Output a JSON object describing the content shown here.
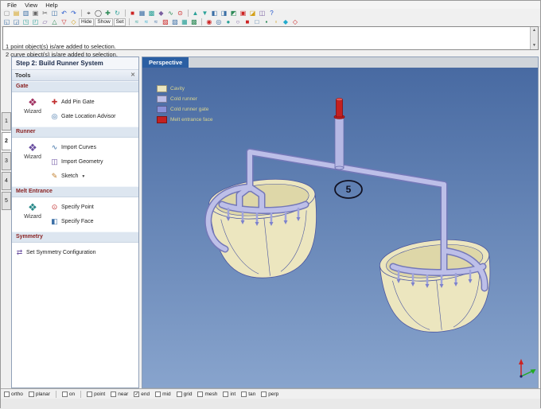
{
  "menu": {
    "items": [
      "File",
      "View",
      "Help"
    ]
  },
  "toolbars": {
    "row1": [
      {
        "n": "new-file",
        "g": "▢",
        "c": "#888888"
      },
      {
        "n": "open-file",
        "g": "▤",
        "c": "#d4a017"
      },
      {
        "n": "save-file",
        "g": "▥",
        "c": "#3a6ea5"
      },
      {
        "n": "print",
        "g": "▣",
        "c": "#666666"
      },
      {
        "n": "cut",
        "g": "✂",
        "c": "#555555"
      },
      {
        "n": "copy",
        "g": "◫",
        "c": "#3a6ea5"
      },
      {
        "n": "undo",
        "g": "↶",
        "c": "#2255cc"
      },
      {
        "n": "redo",
        "g": "↷",
        "c": "#2255cc"
      },
      {
        "type": "sep"
      },
      {
        "n": "select",
        "g": "⌖",
        "c": "#333333"
      },
      {
        "n": "zoom",
        "g": "◯",
        "c": "#333333"
      },
      {
        "n": "pan",
        "g": "✚",
        "c": "#2e8b57"
      },
      {
        "n": "rotate-view",
        "g": "↻",
        "c": "#2aa198"
      },
      {
        "type": "sep"
      },
      {
        "n": "stop",
        "g": "■",
        "c": "#cc2222"
      },
      {
        "n": "grid-display",
        "g": "▦",
        "c": "#3a6ea5"
      },
      {
        "n": "mesh-tool",
        "g": "▩",
        "c": "#2aa198"
      },
      {
        "n": "surface-tool",
        "g": "◆",
        "c": "#7a5fa0"
      },
      {
        "n": "curve-tool",
        "g": "∿",
        "c": "#2e8b57"
      },
      {
        "n": "point-tool",
        "g": "⊙",
        "c": "#cc2222"
      },
      {
        "type": "sep"
      },
      {
        "n": "analysis-up",
        "g": "▲",
        "c": "#2aa198"
      },
      {
        "n": "analysis-down",
        "g": "▼",
        "c": "#2aa198"
      },
      {
        "n": "shade-left",
        "g": "◧",
        "c": "#3a6ea5"
      },
      {
        "n": "shade-right",
        "g": "◨",
        "c": "#3a6ea5"
      },
      {
        "n": "shade-corner",
        "g": "◩",
        "c": "#2e8b57"
      },
      {
        "n": "flag-red",
        "g": "▣",
        "c": "#cc2222"
      },
      {
        "n": "shade-fill",
        "g": "◪",
        "c": "#d4a017"
      },
      {
        "n": "layers",
        "g": "◫",
        "c": "#7a5fa0"
      },
      {
        "n": "help-tool",
        "g": "?",
        "c": "#2255cc"
      }
    ],
    "row2": [
      {
        "n": "view-quad-1",
        "g": "◱",
        "c": "#3a6ea5"
      },
      {
        "n": "view-quad-2",
        "g": "◲",
        "c": "#3a6ea5"
      },
      {
        "n": "view-quad-3",
        "g": "◳",
        "c": "#2aa198"
      },
      {
        "n": "view-quad-4",
        "g": "◰",
        "c": "#2aa198"
      },
      {
        "n": "plane-tool",
        "g": "▱",
        "c": "#7a5fa0"
      },
      {
        "n": "tri-up",
        "g": "△",
        "c": "#2e8b57"
      },
      {
        "n": "tri-down",
        "g": "▽",
        "c": "#cc2222"
      },
      {
        "n": "diamond-tool",
        "g": "◇",
        "c": "#d4a017"
      },
      {
        "type": "text",
        "label": "Hide"
      },
      {
        "type": "text",
        "label": "Show"
      },
      {
        "type": "text",
        "label": "Set"
      },
      {
        "type": "sep"
      },
      {
        "n": "wave-teal",
        "g": "≈",
        "c": "#2aa198"
      },
      {
        "n": "wave-cyan",
        "g": "≈",
        "c": "#22aacc"
      },
      {
        "n": "wave-blue",
        "g": "≈",
        "c": "#3a6ea5"
      },
      {
        "n": "hatch-red",
        "g": "▨",
        "c": "#cc2222"
      },
      {
        "n": "hatch-blue",
        "g": "▧",
        "c": "#3a6ea5"
      },
      {
        "n": "hatch-teal",
        "g": "▦",
        "c": "#2aa198"
      },
      {
        "n": "hatch-green",
        "g": "▩",
        "c": "#2e8b57"
      },
      {
        "type": "sep"
      },
      {
        "n": "target-red",
        "g": "◉",
        "c": "#cc2222"
      },
      {
        "n": "target-blue",
        "g": "◎",
        "c": "#3a6ea5"
      },
      {
        "n": "dot-teal",
        "g": "●",
        "c": "#2aa198"
      },
      {
        "n": "ring-purple",
        "g": "○",
        "c": "#7a5fa0"
      },
      {
        "n": "square-red",
        "g": "■",
        "c": "#cc2222"
      },
      {
        "n": "square-blue",
        "g": "□",
        "c": "#3a6ea5"
      },
      {
        "n": "square-green",
        "g": "▪",
        "c": "#2e8b57"
      },
      {
        "n": "square-yellow",
        "g": "▫",
        "c": "#d4a017"
      },
      {
        "n": "gem-cyan",
        "g": "◆",
        "c": "#22aacc"
      },
      {
        "n": "gem-red",
        "g": "◇",
        "c": "#cc2222"
      }
    ]
  },
  "log": {
    "lines": [
      "1 point object(s) is/are added to selection.",
      "2 curve object(s) is/are added to selection."
    ]
  },
  "steps": {
    "tabs": [
      "1",
      "2",
      "3",
      "4",
      "5"
    ],
    "active": "2"
  },
  "panel": {
    "title": "Step 2: Build Runner System",
    "tools_header": "Tools",
    "sections": [
      {
        "title": "Gate",
        "wizard": {
          "label": "Wizard",
          "icon": "❖",
          "color": "#a03060"
        },
        "items": [
          {
            "label": "Add Pin Gate",
            "icon": "✚",
            "color": "#c23030"
          },
          {
            "label": "Gate Location Advisor",
            "icon": "◎",
            "color": "#3a6ea5"
          }
        ]
      },
      {
        "title": "Runner",
        "wizard": {
          "label": "Wizard",
          "icon": "❖",
          "color": "#6a4fa0"
        },
        "items": [
          {
            "label": "Import Curves",
            "icon": "∿",
            "color": "#3a6ea5"
          },
          {
            "label": "Import Geometry",
            "icon": "◫",
            "color": "#6a4fa0"
          },
          {
            "label": "Sketch",
            "icon": "✎",
            "color": "#c28030",
            "caret": true
          }
        ]
      },
      {
        "title": "Melt Entrance",
        "wizard": {
          "label": "Wizard",
          "icon": "❖",
          "color": "#2a8a8a"
        },
        "items": [
          {
            "label": "Specify Point",
            "icon": "⊙",
            "color": "#c23030"
          },
          {
            "label": "Specify Face",
            "icon": "◧",
            "color": "#3a6ea5"
          }
        ]
      },
      {
        "title": "Symmetry",
        "wizard": null,
        "items": [
          {
            "label": "Set Symmetry Configuration",
            "icon": "⇄",
            "color": "#6a4fa0"
          }
        ]
      }
    ]
  },
  "viewport": {
    "tab": "Perspective",
    "annotation": "5",
    "legend": [
      {
        "label": "Cavity",
        "color": "#ece6bf"
      },
      {
        "label": "Cold runner",
        "color": "#bdbfe8"
      },
      {
        "label": "Cold runner gate",
        "color": "#8890d8"
      },
      {
        "label": "Melt entrance face",
        "color": "#c32020"
      }
    ]
  },
  "colors": {
    "viewport_bg_top": "#486aa2",
    "viewport_bg_bottom": "#88a4cd",
    "cavity": "#ece6bf",
    "cavity_interior": "#ded7a8",
    "runner_light": "#bdbfe8",
    "runner_dark": "#7478b8",
    "gate": "#8890d8",
    "melt_entrance": "#c32020",
    "geometry_outline": "#4a55a0",
    "tab_active": "#2b5fa3",
    "section_header_text": "#8a2222"
  },
  "snapbar": {
    "items": [
      {
        "label": "ortho",
        "checked": false
      },
      {
        "label": "planar",
        "checked": false
      },
      {
        "type": "sep"
      },
      {
        "label": "on",
        "checked": false
      },
      {
        "type": "sep"
      },
      {
        "label": "point",
        "checked": false
      },
      {
        "label": "near",
        "checked": false
      },
      {
        "label": "end",
        "checked": true
      },
      {
        "label": "mid",
        "checked": false
      },
      {
        "label": "grid",
        "checked": false
      },
      {
        "label": "mesh",
        "checked": false
      },
      {
        "label": "int",
        "checked": false
      },
      {
        "label": "tan",
        "checked": false
      },
      {
        "label": "perp",
        "checked": false
      }
    ]
  }
}
